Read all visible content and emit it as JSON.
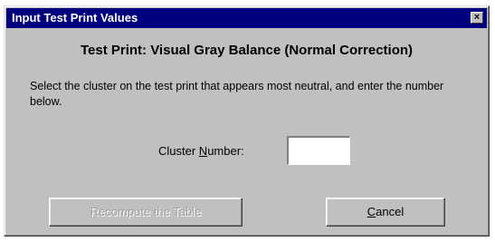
{
  "window": {
    "title": "Input Test Print Values",
    "close_glyph": "×"
  },
  "heading": "Test Print: Visual Gray Balance (Normal Correction)",
  "instruction": "Select the cluster on the test print that appears most neutral, and enter the number below.",
  "cluster": {
    "label_prefix": "Cluster ",
    "label_accel": "N",
    "label_suffix": "umber:",
    "value": "",
    "placeholder": ""
  },
  "buttons": {
    "recompute": "Recompute the Table",
    "cancel_accel": "C",
    "cancel_rest": "ancel"
  },
  "colors": {
    "titlebar": "#00007e",
    "dialog_bg": "#c0c0c0"
  }
}
